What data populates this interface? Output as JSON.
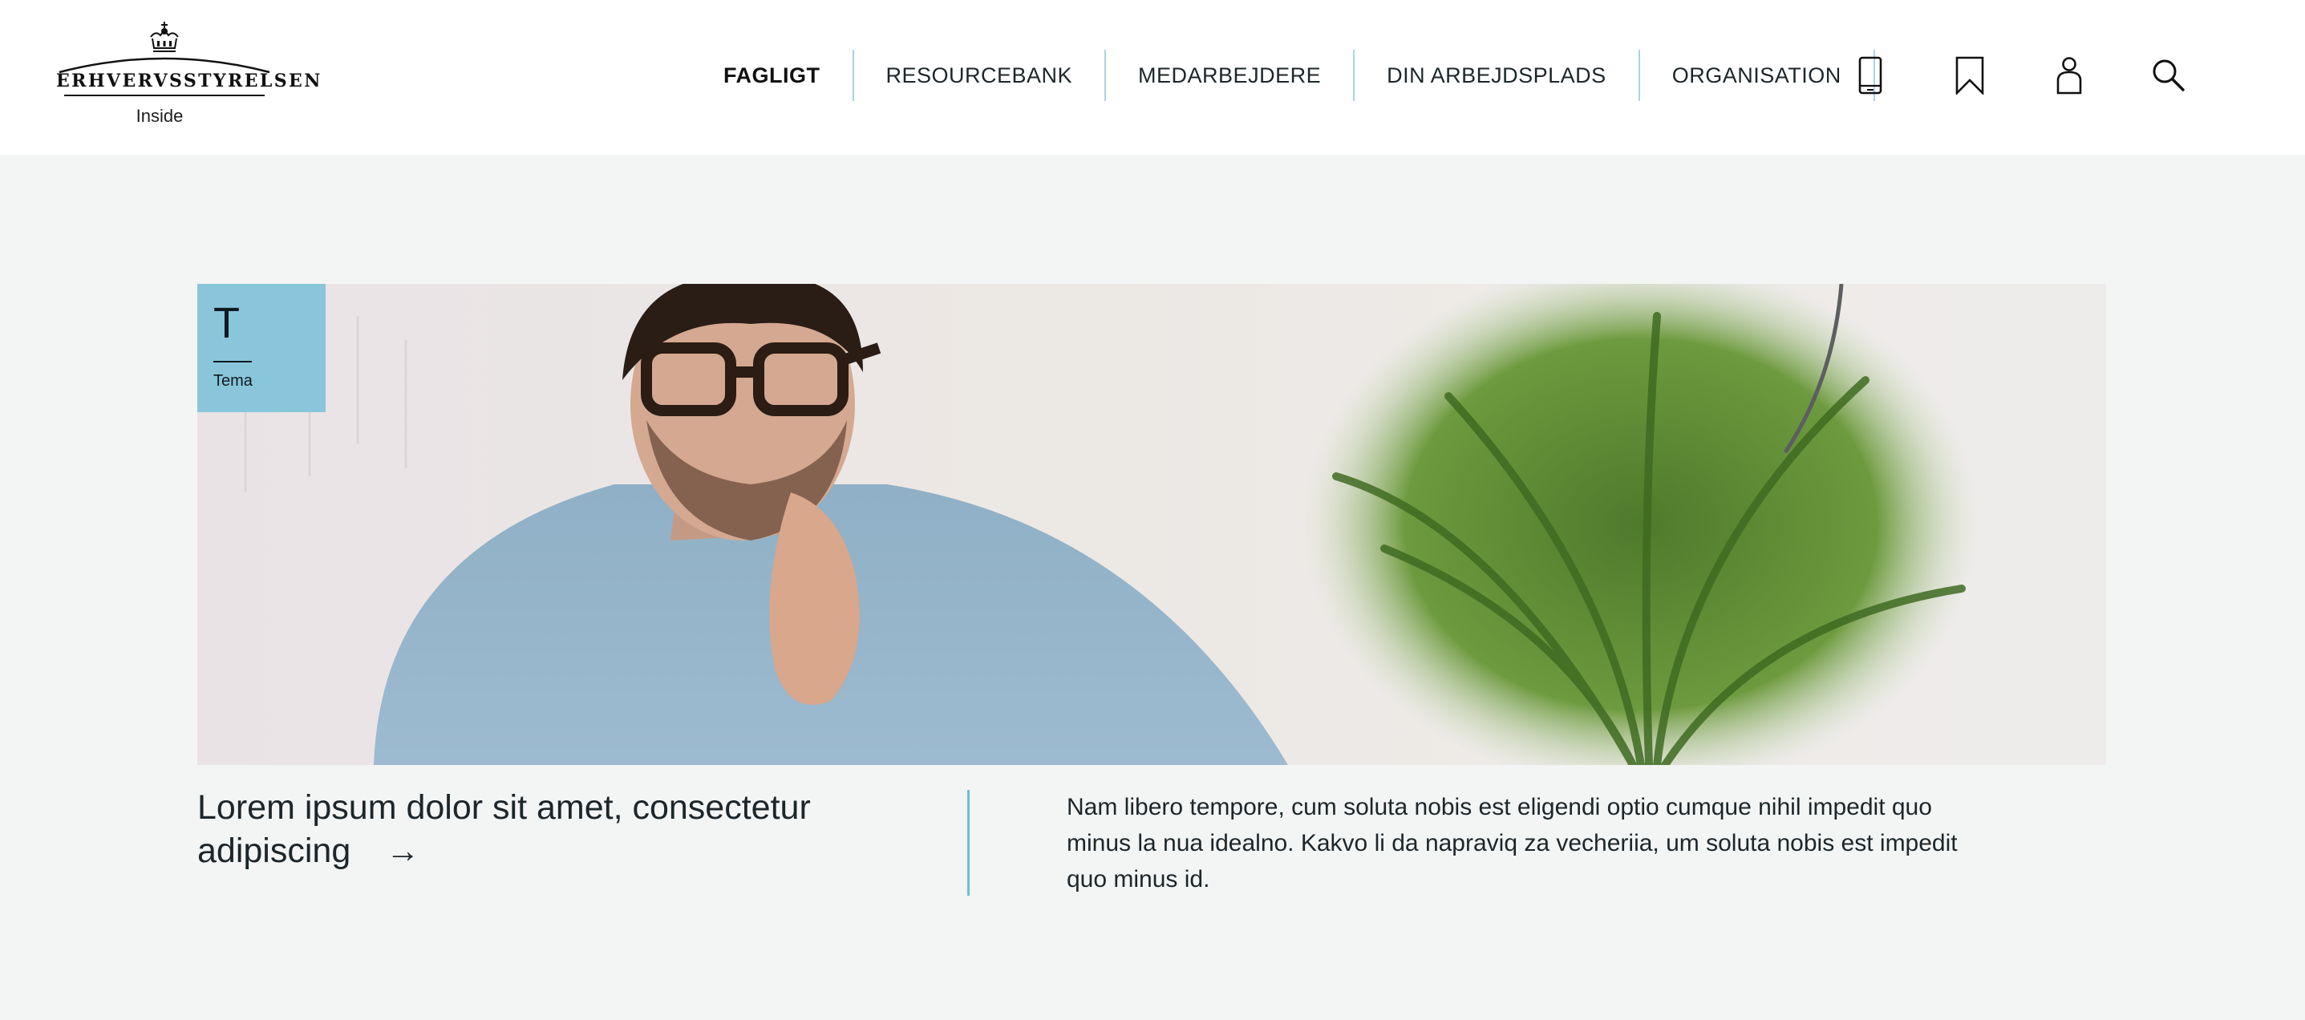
{
  "logo": {
    "brand": "ERHVERVSSTYRELSEN",
    "subtitle": "Inside"
  },
  "nav": {
    "items": [
      {
        "label": "FAGLIGT",
        "active": true
      },
      {
        "label": "RESOURCEBANK",
        "active": false
      },
      {
        "label": "MEDARBEJDERE",
        "active": false
      },
      {
        "label": "DIN ARBEJDSPLADS",
        "active": false
      },
      {
        "label": "ORGANISATION",
        "active": false
      }
    ],
    "separator_color": "#a9d4e3"
  },
  "header_icons": [
    "phone-icon",
    "bookmark-icon",
    "user-icon",
    "search-icon"
  ],
  "hero": {
    "tag_letter": "T",
    "tag_label": "Tema",
    "tag_color": "#89c6dc",
    "image_description": "man-with-glasses-and-plant"
  },
  "article": {
    "headline": "Lorem ipsum dolor sit amet, consectetur adipiscing",
    "arrow": "→",
    "body": "Nam libero tempore, cum soluta nobis est eligendi optio cumque nihil impedit quo minus la nua idealno. Kakvo li da napraviq za vecheriia, um soluta nobis est impedit quo minus id."
  },
  "colors": {
    "background": "#f3f5f4",
    "header": "#ffffff",
    "accent": "#71bcd6",
    "text": "#1d262a"
  }
}
